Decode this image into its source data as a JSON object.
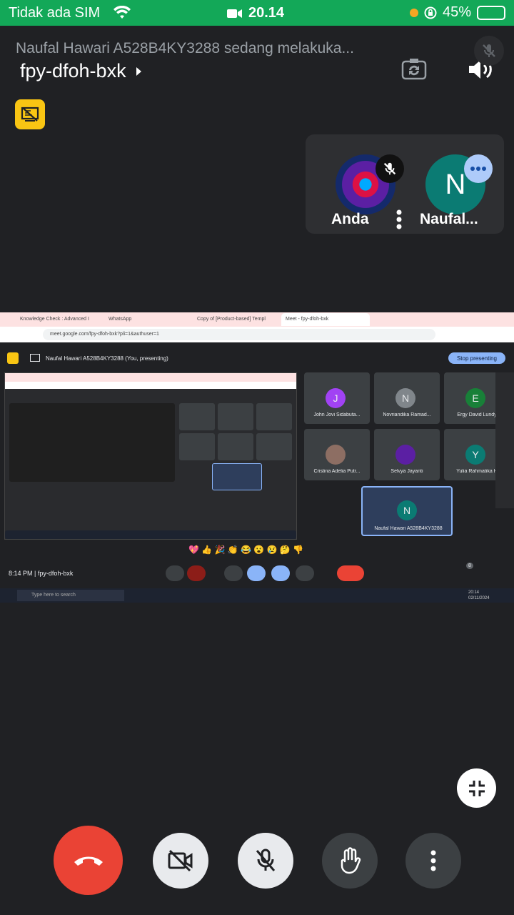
{
  "status_bar": {
    "carrier": "Tidak ada SIM",
    "time": "20.14",
    "battery": "45%",
    "battery_level": 0.45
  },
  "meeting": {
    "ticker": "Naufal Hawari A528B4KY3288 sedang melakuka...",
    "code": "fpy-dfoh-bxk"
  },
  "participants": {
    "you_label": "Anda",
    "other_label": "Naufal...",
    "other_initial": "N"
  },
  "shared_screen": {
    "tabs": [
      "Knowledge Check : Advanced I",
      "WhatsApp",
      "Copy of [Product-based] Templ",
      "Meet - fpy-dfoh-bxk"
    ],
    "url": "meet.google.com/fpy-dfoh-bxk?pli=1&authuser=1",
    "presenting_text": "Naufal Hawari A528B4KY3288 (You, presenting)",
    "stop_label": "Stop presenting",
    "tiles": [
      {
        "initial": "J",
        "name": "John Jovi Sidabuta...",
        "color": "#a142f4"
      },
      {
        "initial": "N",
        "name": "Novriandika Ramad...",
        "color": "#80868b"
      },
      {
        "initial": "E",
        "name": "Ergy David Lundy",
        "color": "#188038"
      },
      {
        "initial": "",
        "name": "Cristina Adelia Putr...",
        "color": "#8d6e63"
      },
      {
        "initial": "",
        "name": "Selvya Jayanti",
        "color": "#5b1fa3"
      },
      {
        "initial": "Y",
        "name": "Yulia Rahmatika H",
        "color": "#0b7b73"
      },
      {
        "initial": "N",
        "name": "Naufal Hawari A528B4KY3288",
        "color": "#0b7b73"
      }
    ],
    "emojis": "💖 👍 🎉 👏 😂 😮 😢 🤔 👎",
    "bottom_time": "8:14 PM",
    "bottom_code": "fpy-dfoh-bxk",
    "people_count": "8",
    "taskbar_search": "Type here to search",
    "taskbar_time": "20:14",
    "taskbar_date": "02/11/2024"
  }
}
